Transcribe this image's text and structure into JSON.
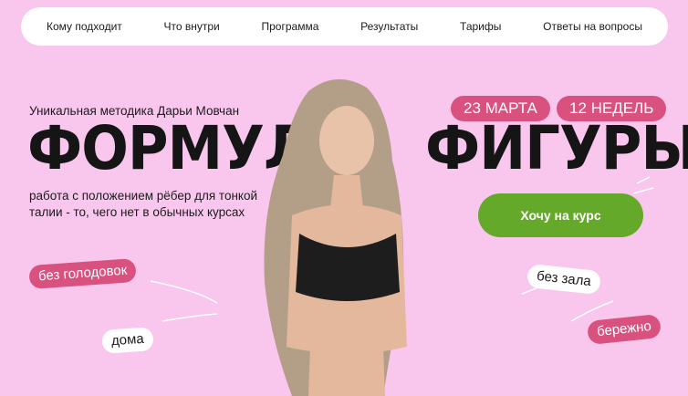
{
  "nav": {
    "items": [
      "Кому подходит",
      "Что внутри",
      "Программа",
      "Результаты",
      "Тарифы",
      "Ответы на вопросы"
    ]
  },
  "hero": {
    "subtitle": "Уникальная методика Дарьи Мовчан",
    "title_left": "ФОРМУЛА",
    "title_right": "ФИГУРЫ",
    "description": "работа с положением рёбер для тонкой талии - то, чего нет в обычных курсах",
    "date_badge": "23 МАРТА",
    "duration_badge": "12 НЕДЕЛЬ",
    "cta_label": "Хочу на курс"
  },
  "tags": {
    "no_diet": "без голодовок",
    "home": "дома",
    "no_gym": "без зала",
    "gentle": "бережно"
  },
  "colors": {
    "background": "#f9c7ee",
    "accent_pink": "#d9527f",
    "cta_green": "#65a92a"
  }
}
